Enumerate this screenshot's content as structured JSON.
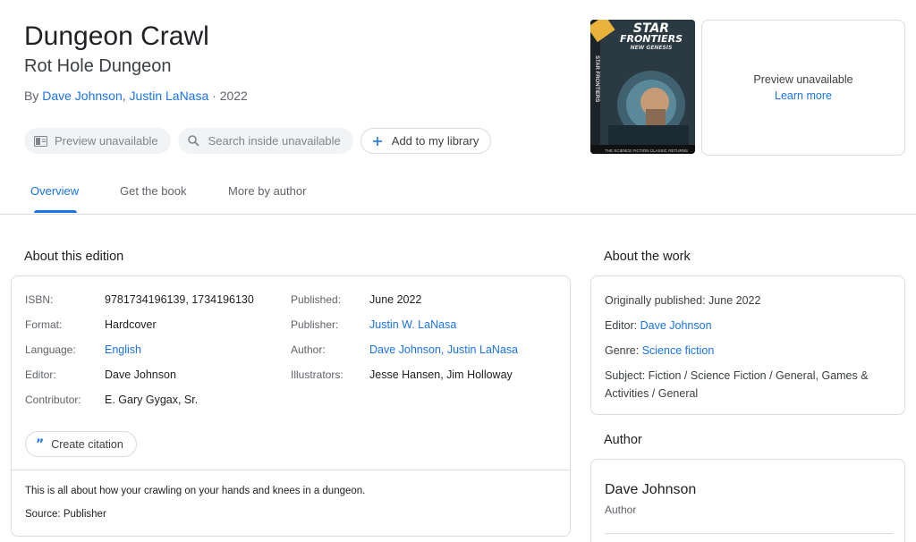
{
  "book": {
    "title": "Dungeon Crawl",
    "subtitle": "Rot Hole Dungeon",
    "by_prefix": "By ",
    "author1": "Dave Johnson",
    "sep": ", ",
    "author2": "Justin LaNasa",
    "year_suffix": " · 2022"
  },
  "actions": {
    "preview": "Preview unavailable",
    "search": "Search inside unavailable",
    "library": "Add to my library"
  },
  "cover": {
    "brand_line1": "STAR",
    "brand_line2": "FRONTIERS",
    "brand_line3": "NEW GENESIS",
    "spine": "STAR FRONTIERS",
    "bottom": "THE SCIENCE FICTION CLASSIC RETURNS"
  },
  "preview_panel": {
    "text": "Preview unavailable",
    "link": "Learn more"
  },
  "tabs": [
    "Overview",
    "Get the book",
    "More by author"
  ],
  "sections": {
    "edition": "About this edition",
    "work": "About the work",
    "author": "Author"
  },
  "edition": {
    "left": [
      {
        "label": "ISBN:",
        "value": "9781734196139, 1734196130",
        "link": false
      },
      {
        "label": "Format:",
        "value": "Hardcover",
        "link": false
      },
      {
        "label": "Language:",
        "value": "English",
        "link": true
      },
      {
        "label": "Editor:",
        "value": "Dave Johnson",
        "link": false
      },
      {
        "label": "Contributor:",
        "value": "E. Gary Gygax, Sr.",
        "link": false
      }
    ],
    "right": [
      {
        "label": "Published:",
        "value": "June 2022",
        "link": false
      },
      {
        "label": "Publisher:",
        "value": "Justin W. LaNasa",
        "link": true
      },
      {
        "label": "Author:",
        "value": "Dave Johnson, Justin LaNasa",
        "link": true
      },
      {
        "label": "Illustrators:",
        "value": "Jesse Hansen, Jim Holloway",
        "link": false
      }
    ],
    "cite_label": "Create citation",
    "description": "This is all about how your crawling on your hands and knees in a dungeon.",
    "source": "Source: Publisher"
  },
  "work": {
    "published_label": "Originally published: ",
    "published_value": "June 2022",
    "editor_label": "Editor: ",
    "editor_value": "Dave Johnson",
    "genre_label": "Genre: ",
    "genre_value": "Science fiction",
    "subject_label": "Subject: ",
    "subject_value": "Fiction / Science Fiction / General, Games & Activities / General"
  },
  "author": {
    "name": "Dave Johnson",
    "role": "Author"
  },
  "colors": {
    "link": "#1a73e8",
    "border": "#dadce0",
    "chip_bg": "#f1f3f4"
  }
}
